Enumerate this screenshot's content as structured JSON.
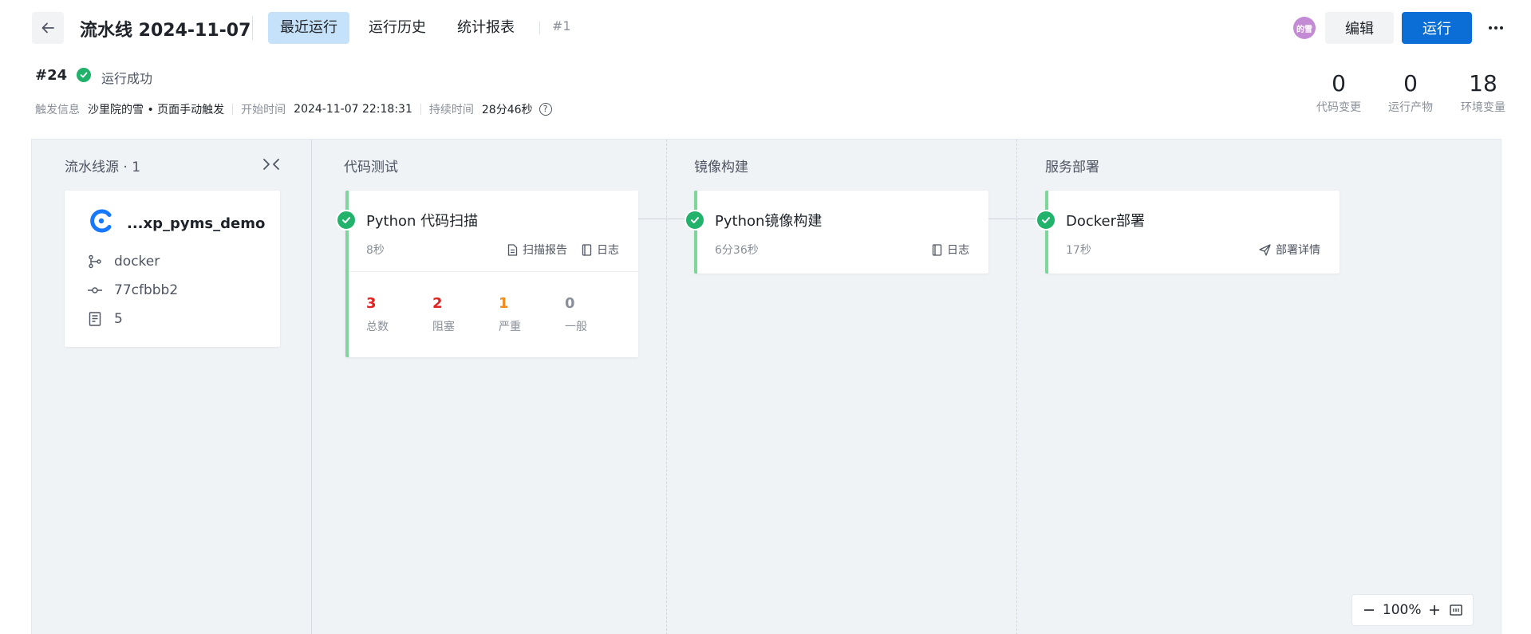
{
  "header": {
    "title": "流水线 2024-11-07",
    "tabs": [
      {
        "label": "最近运行",
        "active": true
      },
      {
        "label": "运行历史",
        "active": false
      },
      {
        "label": "统计报表",
        "active": false
      }
    ],
    "version": "#1",
    "avatar_text": "的雪",
    "edit_label": "编辑",
    "run_label": "运行"
  },
  "run": {
    "number": "#24",
    "status": "运行成功",
    "trigger_label": "触发信息",
    "trigger_value": "沙里院的雪 • 页面手动触发",
    "start_label": "开始时间",
    "start_value": "2024-11-07 22:18:31",
    "duration_label": "持续时间",
    "duration_value": "28分46秒",
    "help": "?"
  },
  "stats": [
    {
      "value": "0",
      "label": "代码变更"
    },
    {
      "value": "0",
      "label": "运行产物"
    },
    {
      "value": "18",
      "label": "环境变量"
    }
  ],
  "source": {
    "title": "流水线源 · 1",
    "repo": "...xp_pyms_demo",
    "branch": "docker",
    "commit": "77cfbbb2",
    "count": "5"
  },
  "stages": [
    {
      "title": "代码测试",
      "job": "Python 代码扫描",
      "time": "8秒",
      "links": [
        "扫描报告",
        "日志"
      ],
      "scan": [
        {
          "value": "3",
          "label": "总数",
          "color": "#e02424"
        },
        {
          "value": "2",
          "label": "阻塞",
          "color": "#e02424"
        },
        {
          "value": "1",
          "label": "严重",
          "color": "#f28b1e"
        },
        {
          "value": "0",
          "label": "一般",
          "color": "#8a8f99"
        }
      ]
    },
    {
      "title": "镜像构建",
      "job": "Python镜像构建",
      "time": "6分36秒",
      "links": [
        "日志"
      ]
    },
    {
      "title": "服务部署",
      "job": "Docker部署",
      "time": "17秒",
      "links": [
        "部署详情"
      ]
    }
  ],
  "zoom": {
    "level": "100%"
  },
  "colors": {
    "success": "#20b26b",
    "primary": "#0b6ed6",
    "stage_border": "#7fd69b",
    "active_tab": "#c5e2fa"
  }
}
